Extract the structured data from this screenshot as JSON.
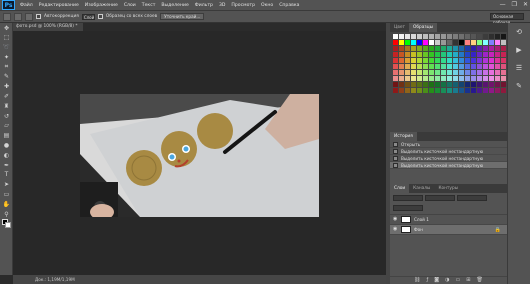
{
  "app": {
    "logo": "Ps"
  },
  "menu": [
    "Файл",
    "Редактирование",
    "Изображение",
    "Слои",
    "Текст",
    "Выделение",
    "Фильтр",
    "3D",
    "Просмотр",
    "Окно",
    "Справка"
  ],
  "window_controls": [
    "—",
    "❐",
    "✕"
  ],
  "options_bar": {
    "antialias_label": "Автокоррекция",
    "size_value": "Слой",
    "sample_all_label": "Образец со всех слоев",
    "refine_button": "Уточнить край...",
    "workspace_select": "Основная рабочая среда"
  },
  "document_tab": {
    "title": "фото.psd @ 100% (RGB/8) *"
  },
  "status_bar": {
    "text": "Док.: 1,19M/1,19M"
  },
  "swatches_panel": {
    "tabs": [
      "Цвет",
      "Образцы"
    ]
  },
  "history_panel": {
    "title": "История",
    "items": [
      "Открыть",
      "Выделить кисточкой нестандартную",
      "Выделить кисточкой нестандартную",
      "Выделить кисточкой нестандартную"
    ]
  },
  "layers_panel": {
    "tabs": [
      "Слои",
      "Каналы",
      "Контуры"
    ],
    "layers": [
      {
        "name": "Слой 1",
        "selected": false
      },
      {
        "name": "Фон",
        "selected": true
      }
    ]
  },
  "colors": {
    "accent": "#31a8ff",
    "chrome": "#535353",
    "workspace": "#282828",
    "ball": "#a88a43",
    "eye": "#4aa7e0"
  },
  "icons": {
    "tools": [
      "move-icon",
      "marquee-icon",
      "lasso-icon",
      "magic-wand-icon",
      "crop-icon",
      "eyedropper-icon",
      "healing-icon",
      "brush-icon",
      "clone-stamp-icon",
      "history-brush-icon",
      "eraser-icon",
      "gradient-icon",
      "blur-icon",
      "dodge-icon",
      "pen-icon",
      "type-icon",
      "path-select-icon",
      "rectangle-icon",
      "hand-icon",
      "zoom-icon"
    ],
    "right_strip": [
      "history-icon",
      "actions-icon",
      "adjust-icon",
      "brush-preset-icon"
    ]
  }
}
